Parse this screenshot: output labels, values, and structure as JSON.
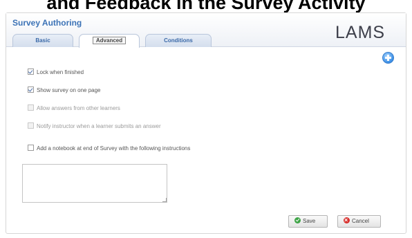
{
  "caption": "and Feedback in the Survey Activity",
  "panel": {
    "title": "Survey Authoring"
  },
  "logo": {
    "text": "LAMS"
  },
  "tabs": [
    {
      "label": "Basic",
      "active": false
    },
    {
      "label": "Advanced",
      "active": true
    },
    {
      "label": "Conditions",
      "active": false
    }
  ],
  "options": [
    {
      "label": "Lock when finished",
      "checked": true,
      "enabled": true
    },
    {
      "label": "Show survey on one page",
      "checked": true,
      "enabled": true
    },
    {
      "label": "Allow answers from other learners",
      "checked": false,
      "enabled": false
    },
    {
      "label": "Notify instructor when a learner submits an answer",
      "checked": false,
      "enabled": false
    },
    {
      "label": "Add a notebook at end of Survey with the following instructions",
      "checked": false,
      "enabled": true
    }
  ],
  "notebook_instructions": {
    "value": ""
  },
  "buttons": {
    "save": "Save",
    "cancel": "Cancel"
  },
  "icons": {
    "add": "plus-circle-icon",
    "save": "check-circle-icon",
    "cancel": "x-circle-icon"
  },
  "colors": {
    "title": "#3b72b6",
    "tab_text": "#3a69a8",
    "save_icon": "#3fa548",
    "cancel_icon": "#d8322f"
  }
}
